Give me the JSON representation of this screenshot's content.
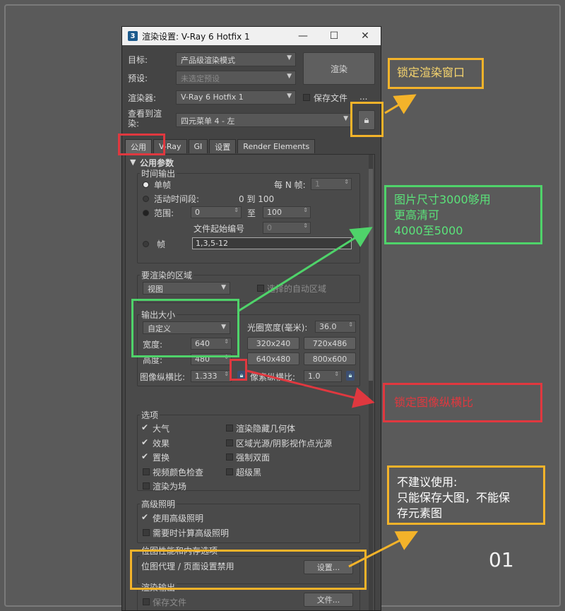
{
  "window": {
    "title": "渲染设置: V-Ray 6 Hotfix 1",
    "app_icon": "3",
    "minimize": "—",
    "maximize": "☐",
    "close": "✕"
  },
  "header": {
    "target_label": "目标:",
    "target_value": "产品级渲染模式",
    "preset_label": "预设:",
    "preset_value": "未选定预设",
    "renderer_label": "渲染器:",
    "renderer_value": "V-Ray 6 Hotfix 1",
    "save_file_label": "保存文件",
    "more": "...",
    "view_label_line1": "查看到渲",
    "view_label_line2": "染:",
    "view_value": "四元菜单 4 - 左",
    "render_button": "渲染",
    "lock_icon": "lock-icon"
  },
  "tabs": [
    "公用",
    "V-Ray",
    "GI",
    "设置",
    "Render Elements"
  ],
  "common": {
    "section_title": "公用参数",
    "time_output": {
      "title": "时间输出",
      "single": "单帧",
      "every_n": "每 N 帧:",
      "every_n_value": "1",
      "active_segment": "活动时间段:",
      "active_range": "0 到 100",
      "range": "范围:",
      "range_from": "0",
      "to": "至",
      "range_to": "100",
      "file_start": "文件起始编号",
      "file_start_value": "0",
      "frames": "帧",
      "frames_value": "1,3,5-12"
    },
    "area": {
      "title": "要渲染的区域",
      "value": "视图",
      "auto_region": "选择的自动区域"
    },
    "output_size": {
      "title": "输出大小",
      "preset": "自定义",
      "aperture_label": "光圈宽度(毫米):",
      "aperture_value": "36.0",
      "width_label": "宽度:",
      "width_value": "640",
      "height_label": "高度:",
      "height_value": "480",
      "preset_buttons": [
        "320x240",
        "720x486",
        "640x480",
        "800x600"
      ],
      "image_aspect_label": "图像纵横比:",
      "image_aspect_value": "1.333",
      "pixel_aspect_label": "像素纵横比:",
      "pixel_aspect_value": "1.0"
    },
    "options": {
      "title": "选项",
      "items_left": [
        {
          "label": "大气",
          "checked": true
        },
        {
          "label": "效果",
          "checked": true
        },
        {
          "label": "置换",
          "checked": true
        },
        {
          "label": "视频颜色检查",
          "checked": false
        },
        {
          "label": "渲染为场",
          "checked": false
        }
      ],
      "items_right": [
        {
          "label": "渲染隐藏几何体",
          "checked": false
        },
        {
          "label": "区域光源/阴影视作点光源",
          "checked": false
        },
        {
          "label": "强制双面",
          "checked": false
        },
        {
          "label": "超级黑",
          "checked": false
        }
      ]
    },
    "advanced_lighting": {
      "title": "高级照明",
      "use": "使用高级照明",
      "use_checked": true,
      "compute": "需要时计算高级照明",
      "compute_checked": false
    },
    "bitmap": {
      "title": "位图性能和内存选项",
      "proxy": "位图代理 / 页面设置禁用",
      "setup_button": "设置..."
    },
    "render_output": {
      "title": "渲染输出",
      "save_file": "保存文件",
      "files_button": "文件..."
    }
  },
  "annotations": {
    "lock_note": "锁定渲染窗口",
    "size_note_line1": "图片尺寸3000够用",
    "size_note_line2": "更高清可",
    "size_note_line3": "4000至5000",
    "red_note": "锁定图像纵横比",
    "output_note_line1": "不建议使用:",
    "output_note_line2": "只能保存大图，不能保",
    "output_note_line3": "存元素图",
    "page_number": "01"
  },
  "colors": {
    "yellow": "#f3b32a",
    "green": "#4fd36a",
    "red": "#e0383f"
  }
}
